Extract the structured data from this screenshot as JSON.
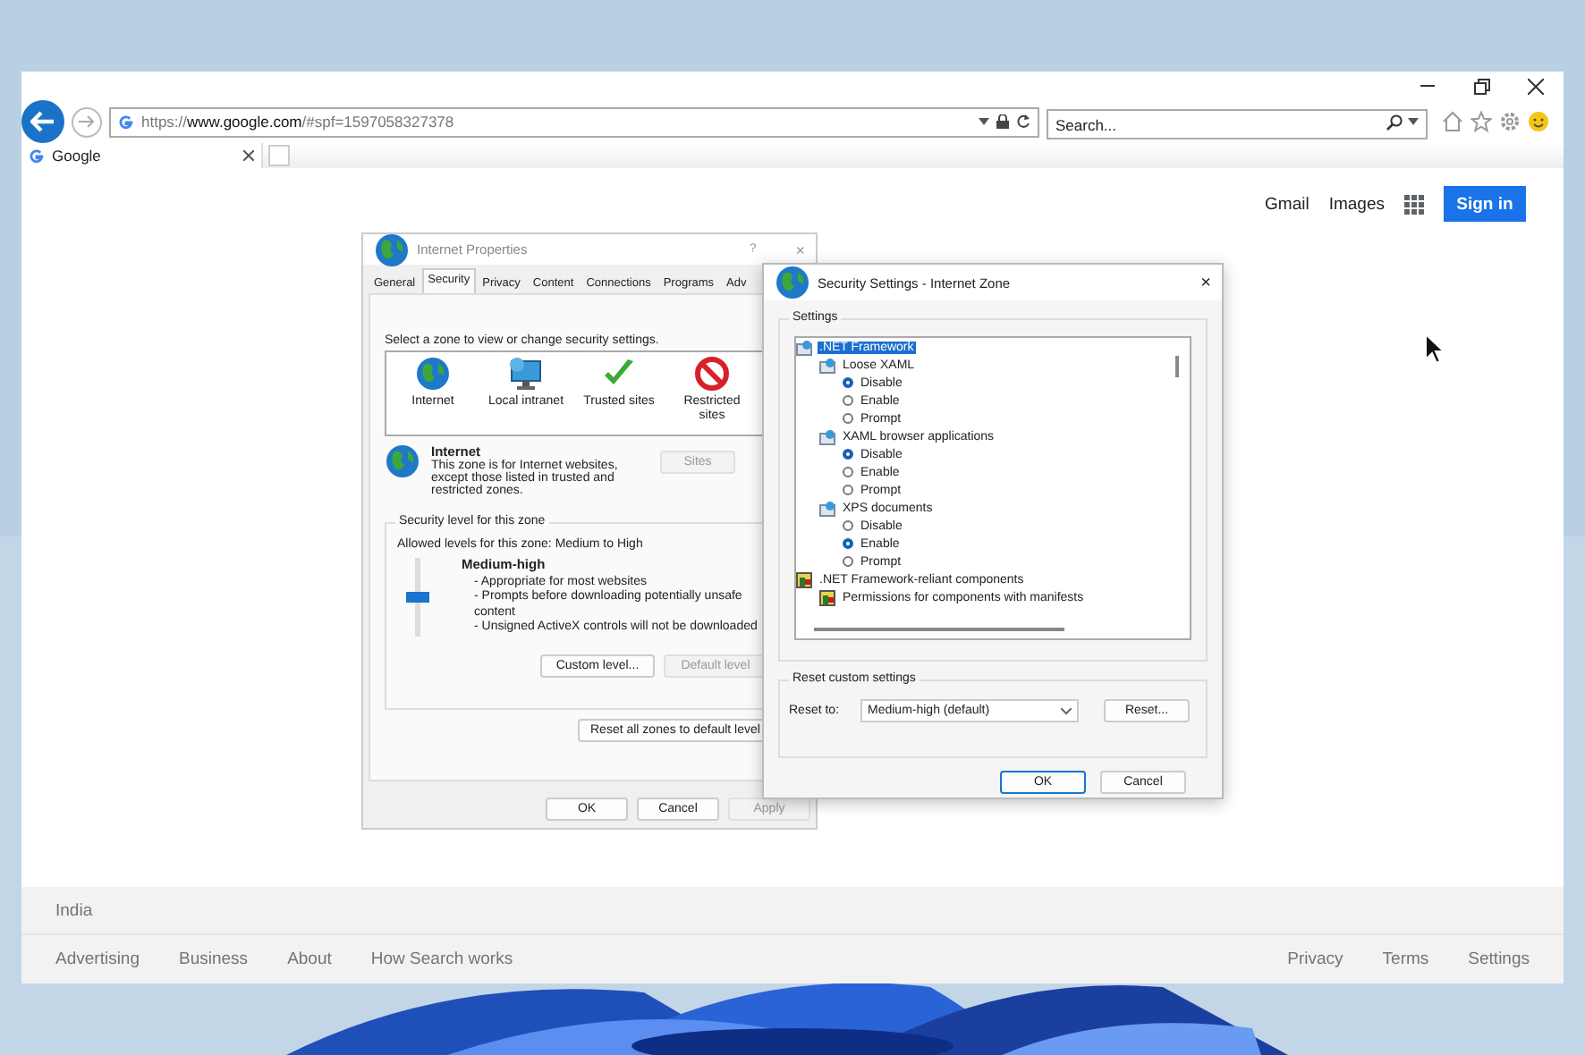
{
  "browser": {
    "address": "https://**www.google.com**/#spf=1597058327378",
    "search": {
      "placeholder": "Search..."
    },
    "tabs": [
      {
        "title": "Google",
        "selected": true
      }
    ]
  },
  "page": {
    "nav_links": [
      "Gmail",
      "Images"
    ],
    "sign_in": "Sign in",
    "screenshot": {
      "internet_properties": {
        "title": "Internet Properties",
        "help": "?",
        "close": "×",
        "tabs": [
          {
            "label": "General",
            "selected": false
          },
          {
            "label": "Security",
            "selected": true
          },
          {
            "label": "Privacy",
            "selected": false
          },
          {
            "label": "Content",
            "selected": false
          },
          {
            "label": "Connections",
            "selected": false
          },
          {
            "label": "Programs",
            "selected": false
          },
          {
            "label": "Adv",
            "selected": false
          }
        ],
        "zone_prompt": "Select a zone to view or change security settings.",
        "zones": [
          {
            "label": "Internet",
            "kind": "globe"
          },
          {
            "label": "Local intranet",
            "kind": "intranet"
          },
          {
            "label": "Trusted sites",
            "kind": "trusted"
          },
          {
            "label": "Restricted sites",
            "kind": "restricted"
          }
        ],
        "zone_name": "Internet",
        "zone_description": "This zone is for Internet websites, except those listed in trusted and restricted zones.",
        "sites_button": {
          "label": "Sites",
          "disabled": true
        },
        "security_group": {
          "title": "Security level for this zone",
          "allowed": "Allowed levels for this zone: Medium to High",
          "level_name": "Medium-high",
          "level": 0.5,
          "bullets": [
            "- Appropriate for most websites",
            "- Prompts before downloading potentially unsafe content",
            "- Unsigned ActiveX controls will not be downloaded"
          ],
          "custom_button": {
            "label": "Custom level...",
            "disabled": false
          },
          "default_button": {
            "label": "Default level",
            "disabled": true
          }
        },
        "reset_all_button": "Reset all zones to default level",
        "buttons": [
          {
            "label": "OK",
            "disabled": false
          },
          {
            "label": "Cancel",
            "disabled": false
          },
          {
            "label": "Apply",
            "disabled": true
          }
        ]
      },
      "security_settings": {
        "title": "Security Settings - Internet Zone",
        "close": "×",
        "settings_label": "Settings",
        "tree": [
          {
            "label": ".NET Framework",
            "kind": "net",
            "selected": true,
            "children": [
              {
                "label": "Loose XAML",
                "kind": "net",
                "selected": false,
                "children": [
                  {
                    "label": "Disable",
                    "kind": "radio",
                    "checked": true
                  },
                  {
                    "label": "Enable",
                    "kind": "radio",
                    "checked": false
                  },
                  {
                    "label": "Prompt",
                    "kind": "radio",
                    "checked": false
                  }
                ]
              },
              {
                "label": "XAML browser applications",
                "kind": "net",
                "selected": false,
                "children": [
                  {
                    "label": "Disable",
                    "kind": "radio",
                    "checked": true
                  },
                  {
                    "label": "Enable",
                    "kind": "radio",
                    "checked": false
                  },
                  {
                    "label": "Prompt",
                    "kind": "radio",
                    "checked": false
                  }
                ]
              },
              {
                "label": "XPS documents",
                "kind": "net",
                "selected": false,
                "children": [
                  {
                    "label": "Disable",
                    "kind": "radio",
                    "checked": false
                  },
                  {
                    "label": "Enable",
                    "kind": "radio",
                    "checked": true
                  },
                  {
                    "label": "Prompt",
                    "kind": "radio",
                    "checked": false
                  }
                ]
              }
            ]
          },
          {
            "label": ".NET Framework-reliant components",
            "kind": "component",
            "selected": false,
            "children": [
              {
                "label": "Permissions for components with manifests",
                "kind": "component",
                "selected": false
              }
            ]
          }
        ],
        "reset_group": {
          "title": "Reset custom settings",
          "reset_to_label": "Reset to:",
          "reset_to_value": "Medium-high (default)",
          "reset_button": "Reset..."
        },
        "buttons": [
          {
            "label": "OK",
            "default": true
          },
          {
            "label": "Cancel",
            "default": false
          }
        ]
      }
    }
  },
  "footer": {
    "country": "India",
    "left_links": [
      "Advertising",
      "Business",
      "About",
      "How Search works"
    ],
    "right_links": [
      "Privacy",
      "Terms",
      "Settings"
    ]
  }
}
